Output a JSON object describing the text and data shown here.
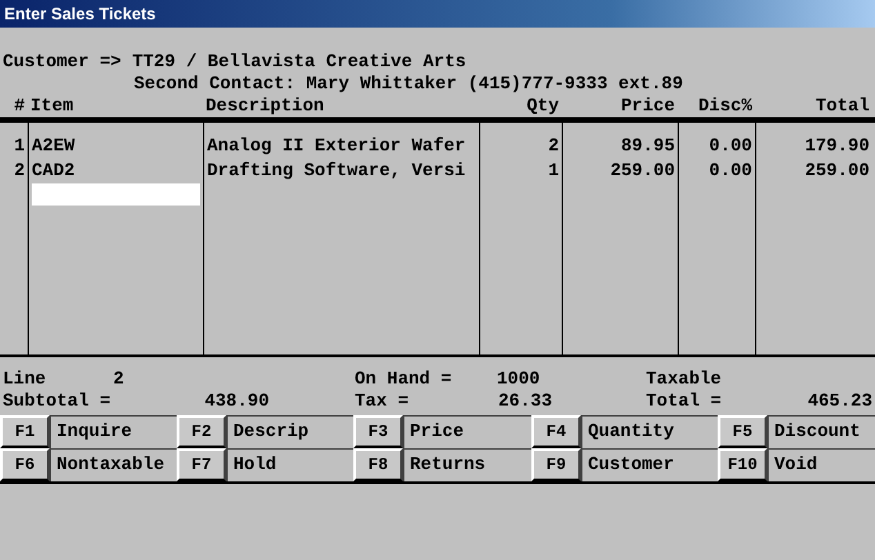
{
  "window": {
    "title": "Enter Sales Tickets"
  },
  "customer": {
    "label": "Customer =>",
    "value": "TT29 / Bellavista Creative Arts",
    "contact": "Second Contact: Mary Whittaker (415)777-9333 ext.89"
  },
  "table": {
    "columns": [
      "#",
      "Item",
      "Description",
      "Qty",
      "Price",
      "Disc%",
      "Total"
    ],
    "rows": [
      {
        "cells": [
          "1",
          "A2EW",
          "Analog II Exterior Wafer",
          "2",
          "89.95",
          "0.00",
          "179.90"
        ]
      },
      {
        "cells": [
          "2",
          "CAD2",
          "Drafting Software, Versi",
          "1",
          "259.00",
          "0.00",
          "259.00"
        ]
      }
    ],
    "new_entry": {
      "kind": "input"
    }
  },
  "summary": [
    [
      {
        "label": "Line",
        "value": "2"
      },
      {
        "label": "On Hand =",
        "value": "1000"
      },
      {
        "label": "Taxable"
      }
    ],
    [
      {
        "label": "Subtotal =",
        "value": "438.90"
      },
      {
        "label": "Tax =",
        "value": "26.33"
      },
      {
        "label": "Total =",
        "value": "465.23"
      }
    ]
  ],
  "function_keys": [
    [
      {
        "key": "F1",
        "label": "Inquire"
      },
      {
        "key": "F2",
        "label": "Descrip"
      },
      {
        "key": "F3",
        "label": "Price"
      },
      {
        "key": "F4",
        "label": "Quantity"
      },
      {
        "key": "F5",
        "label": "Discount"
      }
    ],
    [
      {
        "key": "F6",
        "label": "Nontaxable"
      },
      {
        "key": "F7",
        "label": "Hold"
      },
      {
        "key": "F8",
        "label": "Returns"
      },
      {
        "key": "F9",
        "label": "Customer"
      },
      {
        "key": "F10",
        "label": "Void"
      }
    ]
  ]
}
